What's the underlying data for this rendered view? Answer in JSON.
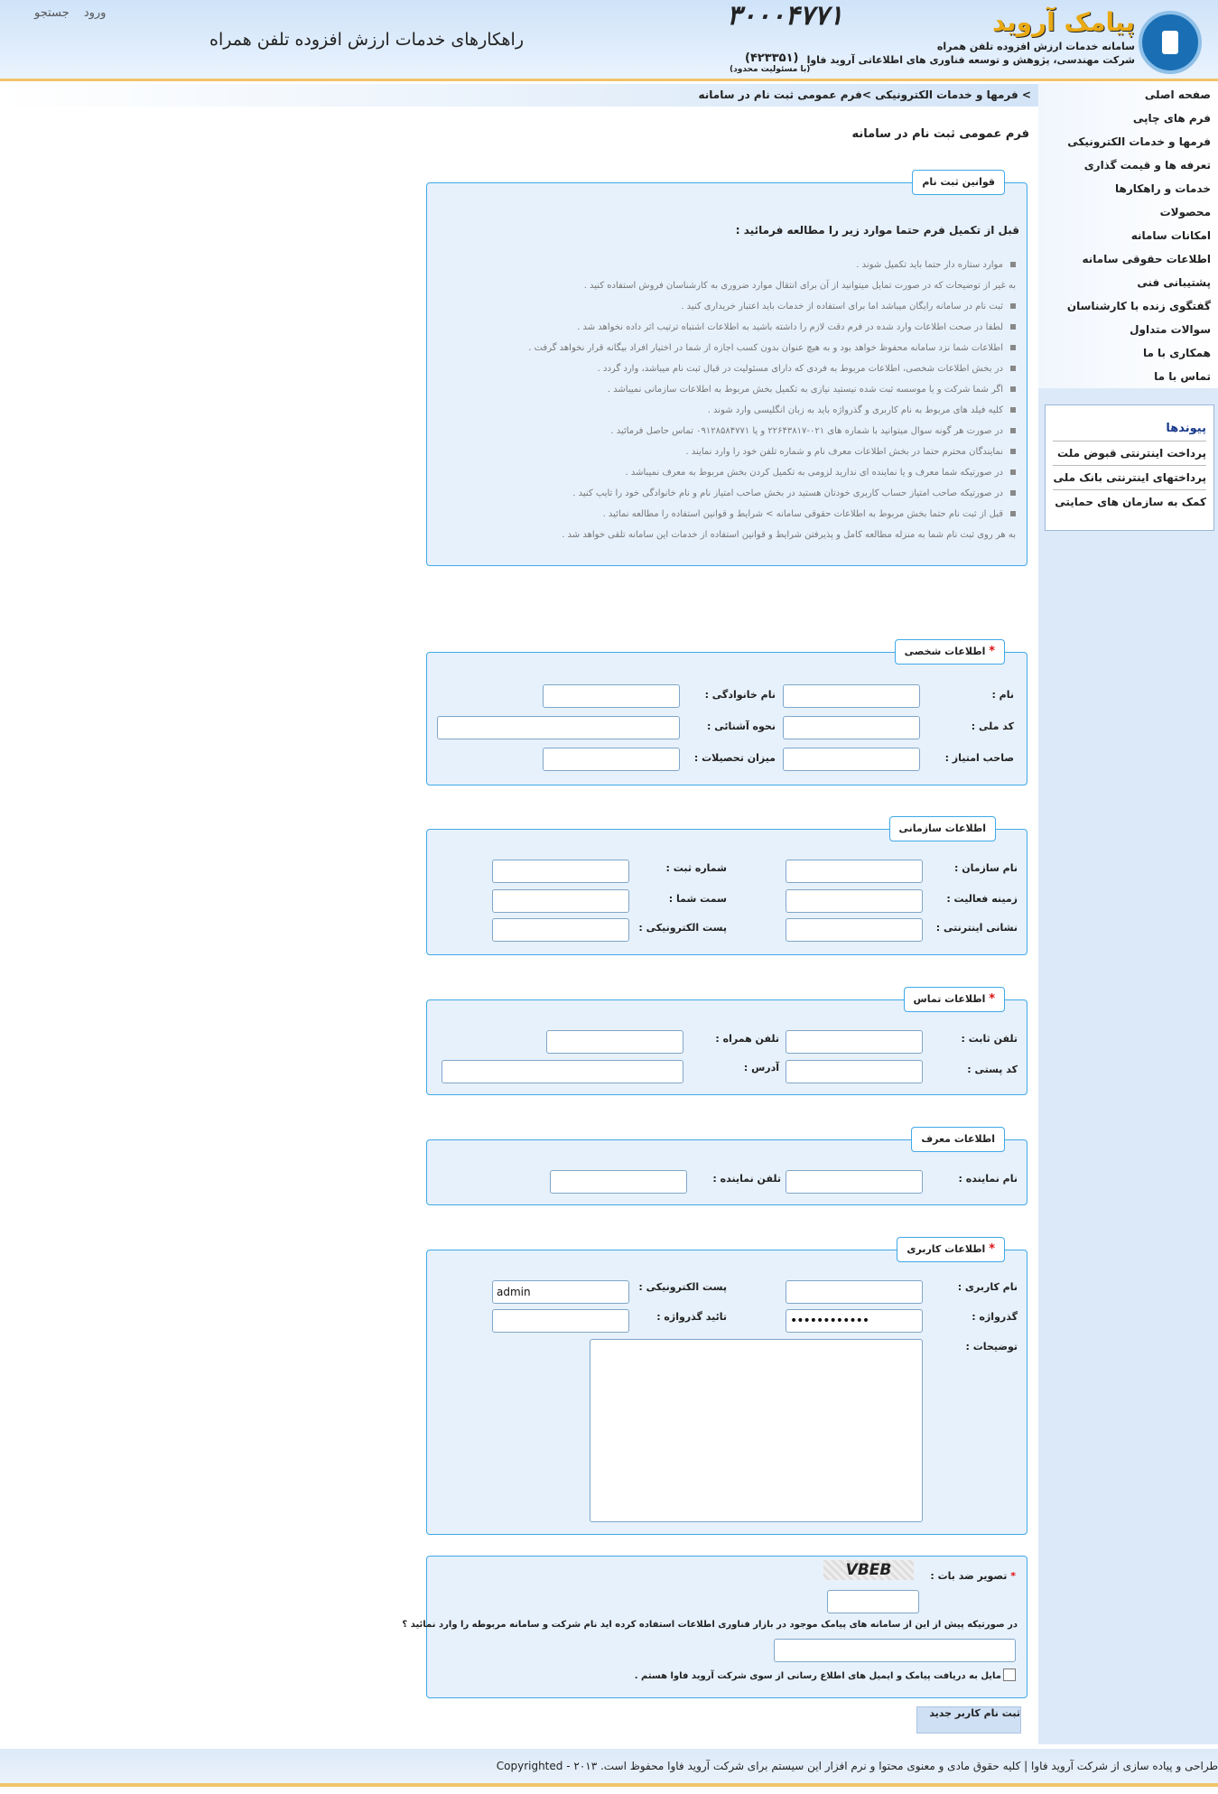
{
  "header": {
    "top_links": [
      "ورود",
      "جستجو"
    ],
    "tagline": "راهکارهای خدمات ارزش افزوده تلفن همراه",
    "brand_number": "۳۰۰۰۴۷۷۱",
    "brand_name": "پیامک آروید",
    "brand_line1": "سامانه خدمات ارزش افزوده تلفن همراه",
    "brand_line2": "شرکت مهندسی، پژوهش و توسعه فناوری های اطلاعاتی آروید فاوا",
    "brand_phone": "(۴۲۳۳۵۱)",
    "brand_limited": "(با مسئولیت محدود)"
  },
  "sidebar": {
    "menu": [
      "صفحه اصلی",
      "فرم های چاپی",
      "فرمها و خدمات الکترونیکی",
      "تعرفه ها و قیمت گذاری",
      "خدمات و راهکارها",
      "محصولات",
      "امکانات سامانه",
      "اطلاعات حقوقی سامانه",
      "پشتیبانی فنی",
      "گفتگوی زنده با کارشناسان",
      "سوالات متداول",
      "همکاری با ما",
      "تماس با ما"
    ],
    "links_title": "پیوندها",
    "links": [
      "پرداخت اینترنتی قبوض ملت",
      "پرداختهای اینترنتی بانک ملی",
      "کمک به سازمان های حمایتی"
    ]
  },
  "breadcrumb": "> فرمها و خدمات الکترونیکی >فرم عمومی ثبت نام در سامانه",
  "page_title": "فرم عمومی ثبت نام در سامانه",
  "rules": {
    "legend": "قوانین ثبت نام",
    "intro": "قبل از تکمیل فرم حتما موارد زیر را مطالعه فرمائید :",
    "items": [
      "موارد ستاره دار حتما باید تکمیل شوند .",
      "به غیر از توضیحات که در صورت تمایل میتوانید از آن برای انتقال موارد ضروری به کارشناسان فروش استفاده کنید .",
      "ثبت نام در سامانه رایگان میباشد اما برای استفاده از خدمات باید اعتبار خریداری کنید .",
      "لطفا در صحت اطلاعات وارد شده در فرم دقت لازم را داشته باشید به اطلاعات اشتباه ترتیب اثر داده نخواهد شد .",
      "اطلاعات شما نزد سامانه محفوظ خواهد بود و به هیچ عنوان بدون کسب اجازه از شما در اختیار افراد بیگانه قرار نخواهد گرفت .",
      "در بخش اطلاعات شخصی، اطلاعات مربوط به فردی که دارای مسئولیت در قبال ثبت نام میباشد، وارد گردد .",
      "اگر شما شرکت و یا موسسه ثبت شده نیستید نیازی به تکمیل بخش مربوط به اطلاعات سازمانی نمیباشد .",
      "کلیه فیلد های مربوط به نام کاربری و گذرواژه باید به زبان انگلیسی وارد شوند .",
      "در صورت هر گونه سوال میتوانید با شماره های ۰۲۱-۲۲۶۴۳۸۱۷ و یا ۰۹۱۲۸۵۸۴۷۷۱ تماس حاصل فرمائید .",
      "نمایندگان محترم حتما در بخش اطلاعات معرف نام و شماره تلفن خود را وارد نمایند .",
      "در صورتیکه شما معرف و یا نماینده ای ندارید لزومی به تکمیل کردن بخش مربوط به معرف نمیباشد .",
      "در صورتیکه صاحب امتیاز حساب کاربری خودتان هستید در بخش صاحب امتیاز نام و نام خانوادگی خود را تایپ کنید .",
      "قبل از ثبت نام حتما بخش مربوط به اطلاعات حقوقی سامانه > شرایط و قوانین استفاده را مطالعه نمائید .",
      "به هر روی ثبت نام شما به منزله مطالعه کامل و پذیرفتن شرایط و قوانین استفاده از خدمات این سامانه تلقی خواهد شد ."
    ]
  },
  "personal": {
    "legend": "اطلاعات شخصی",
    "first_name": "نام :",
    "last_name": "نام خانوادگی :",
    "national_code": "کد ملی :",
    "acquaintance": "نحوه آشنائی :",
    "owner": "صاحب امتیاز :",
    "education": "میزان تحصیلات :"
  },
  "organization": {
    "legend": "اطلاعات سازمانی",
    "org_name": "نام سازمان :",
    "reg_number": "شماره ثبت :",
    "field": "زمینه فعالیت :",
    "position": "سمت شما :",
    "website": "نشانی اینترنتی :",
    "email": "پست الکترونیکی :"
  },
  "contact": {
    "legend": "اطلاعات تماس",
    "phone": "تلفن ثابت :",
    "mobile": "تلفن همراه :",
    "postal": "کد پستی :",
    "address": "آدرس :"
  },
  "referrer": {
    "legend": "اطلاعات معرف",
    "agent_name": "نام نماینده :",
    "agent_phone": "تلفن نماینده :"
  },
  "account": {
    "legend": "اطلاعات کاربری",
    "username": "نام کاربری :",
    "email": "پست الکترونیکی :",
    "email_value": "admin",
    "password": "گذرواژه :",
    "password_value": "••••••••••••",
    "confirm": "تائید گذرواژه :",
    "description": "توضیحات :"
  },
  "captcha": {
    "label": "تصویر ضد بات :",
    "code": "VBEB",
    "question": "در صورتیکه پیش از این از سامانه های پیامک موجود در بازار فناوری اطلاعات استفاده کرده اید نام شرکت و سامانه مربوطه را وارد نمائید ؟",
    "consent": "مایل به دریافت پیامک و ایمیل های اطلاع رسانی از سوی شرکت آروید فاوا هستم ."
  },
  "submit_label": "ثبت نام کاربر جدید",
  "footer": "طراحی و پیاده سازی از شرکت آروید فاوا | کلیه حقوق مادی و معنوی محتوا و نرم افزار این سیستم برای شرکت آروید فاوا محفوظ است. ۲۰۱۳ - Copyrighted",
  "colors": {
    "accent": "#3fa9e8",
    "header_bg": "#cfe3f9",
    "border_line": "#f2c36a",
    "star": "#dd1111"
  }
}
